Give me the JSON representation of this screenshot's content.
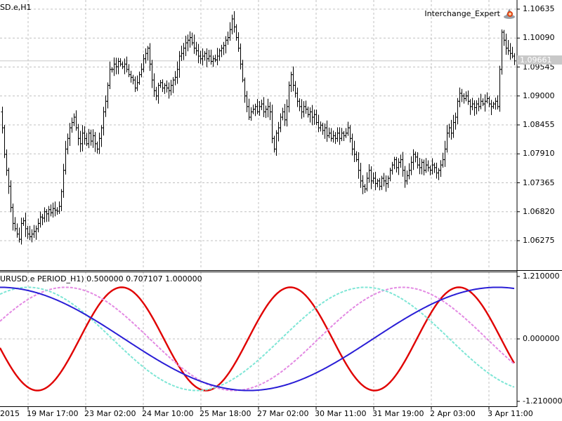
{
  "window": {
    "title": "SD.e,H1"
  },
  "expert": {
    "name": "Interchange_Expert",
    "icon": "expert-advisor-hat-icon"
  },
  "price_axis": {
    "ticks": [
      "1.10635",
      "1.10090",
      "1.09545",
      "1.09000",
      "1.08455",
      "1.07910",
      "1.07365",
      "1.06820",
      "1.06275"
    ],
    "current_price": "1.09661"
  },
  "indicator": {
    "title": "URUSD.e PERIOD_H1) 0.500000 0.707107 1.000000",
    "ticks": [
      "1.210000",
      "0.000000",
      "-1.210000"
    ]
  },
  "time_axis": {
    "labels": [
      "2015",
      "19 Mar 17:00",
      "23 Mar 02:00",
      "24 Mar 10:00",
      "25 Mar 18:00",
      "27 Mar 02:00",
      "30 Mar 11:00",
      "31 Mar 19:00",
      "2 Apr 03:00",
      "3 Apr 11:00"
    ]
  },
  "colors": {
    "background": "#ffffff",
    "grid": "#c0c0c0",
    "bars": "#000000",
    "series_red": "#e00000",
    "series_blue": "#2a1ed6",
    "series_violet": "#e38ae3",
    "series_cyan": "#7fe6d6"
  },
  "chart_data": [
    {
      "type": "ohlc",
      "ylim": [
        1.06,
        1.108
      ],
      "close_points": [
        [
          0,
          1.087
        ],
        [
          3,
          1.084
        ],
        [
          6,
          1.079
        ],
        [
          9,
          1.076
        ],
        [
          12,
          1.073
        ],
        [
          15,
          1.069
        ],
        [
          18,
          1.066
        ],
        [
          21,
          1.065
        ],
        [
          24,
          1.064
        ],
        [
          27,
          1.063
        ],
        [
          30,
          1.066
        ],
        [
          33,
          1.0665
        ],
        [
          36,
          1.065
        ],
        [
          39,
          1.064
        ],
        [
          42,
          1.0635
        ],
        [
          45,
          1.064
        ],
        [
          48,
          1.0645
        ],
        [
          51,
          1.065
        ],
        [
          54,
          1.066
        ],
        [
          57,
          1.0672
        ],
        [
          60,
          1.067
        ],
        [
          63,
          1.0682
        ],
        [
          66,
          1.0678
        ],
        [
          69,
          1.0686
        ],
        [
          72,
          1.068
        ],
        [
          75,
          1.0688
        ],
        [
          78,
          1.0685
        ],
        [
          81,
          1.0683
        ],
        [
          84,
          1.0692
        ],
        [
          87,
          1.072
        ],
        [
          90,
          1.076
        ],
        [
          93,
          1.08
        ],
        [
          96,
          1.082
        ],
        [
          99,
          1.084
        ],
        [
          102,
          1.085
        ],
        [
          105,
          1.086
        ],
        [
          108,
          1.084
        ],
        [
          111,
          1.082
        ],
        [
          114,
          1.081
        ],
        [
          117,
          1.083
        ],
        [
          120,
          1.082
        ],
        [
          123,
          1.081
        ],
        [
          126,
          1.083
        ],
        [
          129,
          1.0815
        ],
        [
          132,
          1.0825
        ],
        [
          135,
          1.081
        ],
        [
          138,
          1.08
        ],
        [
          141,
          1.082
        ],
        [
          144,
          1.084
        ],
        [
          147,
          1.087
        ],
        [
          150,
          1.089
        ],
        [
          153,
          1.092
        ],
        [
          156,
          1.095
        ],
        [
          159,
          1.095
        ],
        [
          162,
          1.096
        ],
        [
          165,
          1.0955
        ],
        [
          168,
          1.0965
        ],
        [
          171,
          1.096
        ],
        [
          174,
          1.0955
        ],
        [
          177,
          1.096
        ],
        [
          180,
          1.095
        ],
        [
          183,
          1.094
        ],
        [
          186,
          1.0935
        ],
        [
          189,
          1.093
        ],
        [
          192,
          1.0915
        ],
        [
          195,
          1.0925
        ],
        [
          198,
          1.094
        ],
        [
          201,
          1.095
        ],
        [
          204,
          1.097
        ],
        [
          207,
          1.098
        ],
        [
          210,
          1.099
        ],
        [
          213,
          1.096
        ],
        [
          216,
          1.093
        ],
        [
          219,
          1.091
        ],
        [
          222,
          1.09
        ],
        [
          225,
          1.092
        ],
        [
          228,
          1.0925
        ],
        [
          231,
          1.0915
        ],
        [
          234,
          1.092
        ],
        [
          237,
          1.0915
        ],
        [
          240,
          1.091
        ],
        [
          243,
          1.092
        ],
        [
          246,
          1.093
        ],
        [
          249,
          1.0935
        ],
        [
          252,
          1.095
        ],
        [
          255,
          1.0975
        ],
        [
          258,
          1.098
        ],
        [
          261,
          1.099
        ],
        [
          264,
          1.1
        ],
        [
          267,
          1.1005
        ],
        [
          270,
          1.101
        ],
        [
          273,
          1.1
        ],
        [
          276,
          1.099
        ],
        [
          279,
          1.0985
        ],
        [
          282,
          1.0975
        ],
        [
          285,
          1.097
        ],
        [
          288,
          1.0975
        ],
        [
          291,
          1.098
        ],
        [
          294,
          1.097
        ],
        [
          297,
          1.0975
        ],
        [
          300,
          1.0965
        ],
        [
          303,
          1.097
        ],
        [
          306,
          1.0968
        ],
        [
          309,
          1.0975
        ],
        [
          312,
          1.0985
        ],
        [
          315,
          1.099
        ],
        [
          318,
          1.0995
        ],
        [
          321,
          1.1005
        ],
        [
          324,
          1.101
        ],
        [
          327,
          1.1025
        ],
        [
          330,
          1.1045
        ],
        [
          333,
          1.103
        ],
        [
          336,
          1.101
        ],
        [
          339,
          1.099
        ],
        [
          342,
          1.096
        ],
        [
          345,
          1.093
        ],
        [
          348,
          1.09
        ],
        [
          351,
          1.088
        ],
        [
          354,
          1.086
        ],
        [
          357,
          1.087
        ],
        [
          360,
          1.0875
        ],
        [
          363,
          1.088
        ],
        [
          366,
          1.087
        ],
        [
          369,
          1.088
        ],
        [
          372,
          1.0885
        ],
        [
          375,
          1.087
        ],
        [
          378,
          1.0875
        ],
        [
          381,
          1.088
        ],
        [
          384,
          1.087
        ],
        [
          387,
          1.082
        ],
        [
          390,
          1.08
        ],
        [
          393,
          1.083
        ],
        [
          396,
          1.084
        ],
        [
          399,
          1.086
        ],
        [
          402,
          1.087
        ],
        [
          405,
          1.0855
        ],
        [
          408,
          1.088
        ],
        [
          411,
          1.092
        ],
        [
          414,
          1.094
        ],
        [
          417,
          1.092
        ],
        [
          420,
          1.0905
        ],
        [
          423,
          1.089
        ],
        [
          426,
          1.088
        ],
        [
          429,
          1.087
        ],
        [
          432,
          1.088
        ],
        [
          435,
          1.0875
        ],
        [
          438,
          1.0865
        ],
        [
          441,
          1.087
        ],
        [
          444,
          1.086
        ],
        [
          447,
          1.0865
        ],
        [
          450,
          1.085
        ],
        [
          453,
          1.084
        ],
        [
          456,
          1.0845
        ],
        [
          459,
          1.0835
        ],
        [
          462,
          1.084
        ],
        [
          465,
          1.0825
        ],
        [
          468,
          1.083
        ],
        [
          471,
          1.082
        ],
        [
          474,
          1.0825
        ],
        [
          477,
          1.082
        ],
        [
          480,
          1.083
        ],
        [
          483,
          1.082
        ],
        [
          486,
          1.083
        ],
        [
          489,
          1.0825
        ],
        [
          492,
          1.083
        ],
        [
          495,
          1.084
        ],
        [
          498,
          1.082
        ],
        [
          501,
          1.08
        ],
        [
          504,
          1.079
        ],
        [
          507,
          1.078
        ],
        [
          510,
          1.076
        ],
        [
          513,
          1.074
        ],
        [
          516,
          1.073
        ],
        [
          519,
          1.0725
        ],
        [
          522,
          1.0745
        ],
        [
          525,
          1.076
        ],
        [
          528,
          1.074
        ],
        [
          531,
          1.0745
        ],
        [
          534,
          1.0735
        ],
        [
          537,
          1.074
        ],
        [
          540,
          1.073
        ],
        [
          543,
          1.0745
        ],
        [
          546,
          1.074
        ],
        [
          549,
          1.0735
        ],
        [
          552,
          1.0745
        ],
        [
          555,
          1.076
        ],
        [
          558,
          1.077
        ],
        [
          561,
          1.078
        ],
        [
          564,
          1.0765
        ],
        [
          567,
          1.0775
        ],
        [
          570,
          1.078
        ],
        [
          573,
          1.076
        ],
        [
          576,
          1.074
        ],
        [
          579,
          1.075
        ],
        [
          582,
          1.076
        ],
        [
          585,
          1.0775
        ],
        [
          588,
          1.079
        ],
        [
          591,
          1.0785
        ],
        [
          594,
          1.077
        ],
        [
          597,
          1.0765
        ],
        [
          600,
          1.0775
        ],
        [
          603,
          1.076
        ],
        [
          606,
          1.077
        ],
        [
          609,
          1.0765
        ],
        [
          612,
          1.076
        ],
        [
          615,
          1.077
        ],
        [
          618,
          1.0765
        ],
        [
          621,
          1.0755
        ],
        [
          624,
          1.076
        ],
        [
          627,
          1.077
        ],
        [
          630,
          1.078
        ],
        [
          633,
          1.08
        ],
        [
          636,
          1.083
        ],
        [
          639,
          1.084
        ],
        [
          642,
          1.083
        ],
        [
          645,
          1.085
        ],
        [
          648,
          1.086
        ],
        [
          651,
          1.089
        ],
        [
          654,
          1.0905
        ],
        [
          657,
          1.09
        ],
        [
          660,
          1.0895
        ],
        [
          663,
          1.09
        ],
        [
          666,
          1.089
        ],
        [
          669,
          1.088
        ],
        [
          672,
          1.0885
        ],
        [
          675,
          1.0878
        ],
        [
          678,
          1.0885
        ],
        [
          681,
          1.088
        ],
        [
          684,
          1.089
        ],
        [
          687,
          1.0885
        ],
        [
          690,
          1.089
        ],
        [
          693,
          1.0895
        ],
        [
          696,
          1.0885
        ],
        [
          699,
          1.088
        ],
        [
          702,
          1.0885
        ],
        [
          705,
          1.089
        ],
        [
          708,
          1.088
        ],
        [
          711,
          1.095
        ],
        [
          714,
          1.102
        ],
        [
          717,
          1.1005
        ],
        [
          720,
          1.099
        ],
        [
          723,
          1.0985
        ],
        [
          726,
          1.098
        ],
        [
          729,
          1.0975
        ],
        [
          732,
          1.0966
        ]
      ]
    },
    {
      "type": "line",
      "ylim": [
        -1.21,
        1.21
      ],
      "series": [
        {
          "color": "#e00000",
          "amplitude": 1.0,
          "phase_deg": -170,
          "period_bars": 80
        },
        {
          "color": "#e38ae3",
          "amplitude": 1.0,
          "phase_deg": 20,
          "period_bars": 160
        },
        {
          "color": "#7fe6d6",
          "amplitude": 1.0,
          "phase_deg": 60,
          "period_bars": 160
        },
        {
          "color": "#2a1ed6",
          "amplitude": 1.0,
          "phase_deg": 90,
          "period_bars": 236
        }
      ]
    }
  ]
}
